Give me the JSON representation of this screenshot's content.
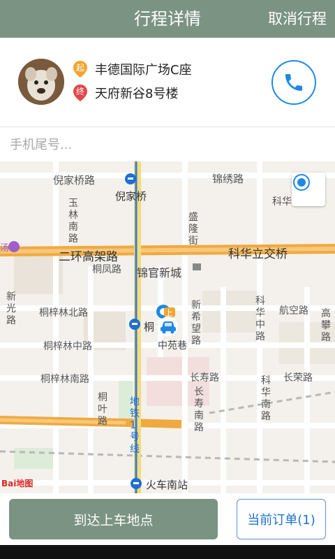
{
  "header": {
    "title": "行程详情",
    "cancel_label": "取消行程"
  },
  "trip": {
    "start_badge": "起",
    "start_location": "丰德国际广场C座",
    "end_badge": "终",
    "end_location": "天府新谷8号楼",
    "call_icon": "phone-icon"
  },
  "phone_tail": {
    "placeholder": "手机尾号..."
  },
  "map": {
    "labels": {
      "nijiaqiao_road": "倪家桥路",
      "nijiaqiao": "倪家桥",
      "jinxiu_road": "锦绣路",
      "kehua_short": "科华",
      "yulin_south": "玉林南路",
      "shenglong_street": "盛隆街",
      "second_ring": "二环高架路",
      "kehua_bridge": "科华立交桥",
      "tongfeng_road": "桐凤路",
      "jinguan_city": "锦官新城",
      "xinguang_road": "新光路",
      "tongzilin_north": "桐梓林北路",
      "tongzilin_station": "桐",
      "xinxiwang_road": "新希望路",
      "kehua_middle": "科华中路",
      "hangkong_road": "航空路",
      "gaopeng_road": "高攀路",
      "tongzilin_middle": "桐梓林中路",
      "zhongyuan_lane": "中苑巷",
      "tongzilin_south": "桐梓林南路",
      "changshou_road": "长寿路",
      "changrong_road": "长荣路",
      "tongye_road": "桐叶路",
      "metro_line1": "地铁1号线",
      "changshou_south": "长寿南路",
      "kehua_south": "科华南路",
      "train_south": "火车南站",
      "shop_mark": "汤",
      "pickup_mark": "上"
    },
    "logo": "Bai地图"
  },
  "actions": {
    "arrive_label": "到达上车地点",
    "order_label": "当前订单(1)"
  },
  "colors": {
    "header": "#7b9382",
    "accent_blue": "#1e88e5",
    "ring_road": "#f0a940"
  }
}
